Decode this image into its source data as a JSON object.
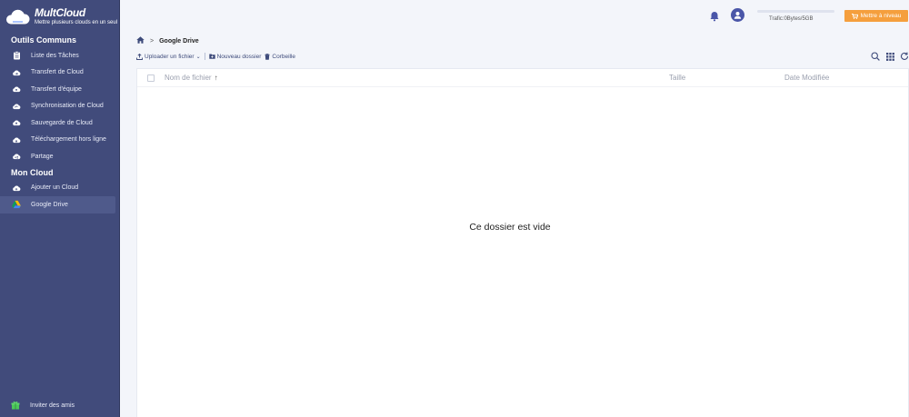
{
  "brand": {
    "name": "MultCloud",
    "tagline": "Mettre plusieurs clouds en un seul"
  },
  "sidebar": {
    "sections": [
      {
        "title": "Outils Communs"
      },
      {
        "title": "Mon Cloud"
      }
    ],
    "common_tools": [
      {
        "label": "Liste des Tâches",
        "icon": "clipboard-icon"
      },
      {
        "label": "Transfert de Cloud",
        "icon": "cloud-transfer-icon"
      },
      {
        "label": "Transfert d'équipe",
        "icon": "cloud-team-icon"
      },
      {
        "label": "Synchronisation de Cloud",
        "icon": "cloud-sync-icon"
      },
      {
        "label": "Sauvegarde de Cloud",
        "icon": "cloud-backup-icon"
      },
      {
        "label": "Téléchargement hors ligne",
        "icon": "cloud-download-icon"
      },
      {
        "label": "Partage",
        "icon": "cloud-share-icon"
      }
    ],
    "my_cloud": [
      {
        "label": "Ajouter un Cloud",
        "icon": "cloud-add-icon"
      },
      {
        "label": "Google Drive",
        "icon": "google-drive-icon",
        "active": true
      }
    ],
    "invite": {
      "label": "Inviter des amis",
      "icon": "gift-icon"
    }
  },
  "header": {
    "traffic_text": "Trafic:0Bytes/5GB",
    "traffic_used_fraction": 0,
    "upgrade_label": "Mettre à niveau"
  },
  "breadcrumb": {
    "current": "Google Drive"
  },
  "toolbar": {
    "upload_label": "Uploader un fichier",
    "new_folder_label": "Nouveau dossier",
    "trash_label": "Corbeille"
  },
  "table": {
    "columns": {
      "name": "Nom de fichier",
      "size": "Taille",
      "date": "Date Modifiée"
    }
  },
  "empty_message": "Ce dossier est vide",
  "colors": {
    "sidebar": "#414b7b",
    "accent": "#f59f3d",
    "avatar": "#4a56a8"
  }
}
